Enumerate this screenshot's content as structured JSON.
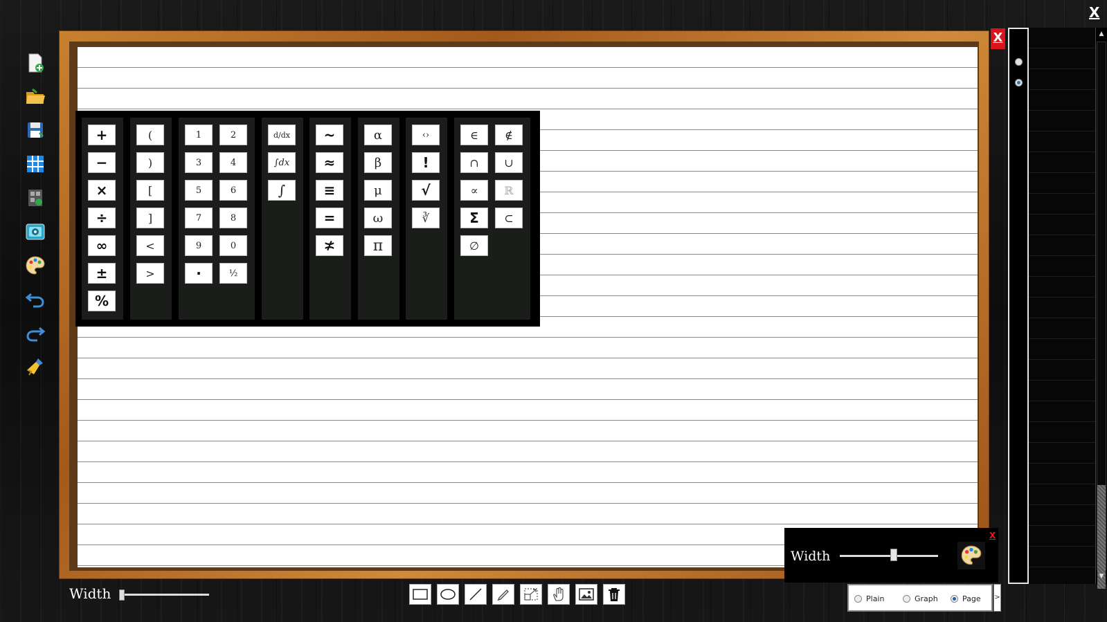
{
  "window": {
    "close_label": "X"
  },
  "left_toolbar": [
    {
      "name": "new-page",
      "icon": "new-page-icon"
    },
    {
      "name": "open",
      "icon": "folder-open-icon"
    },
    {
      "name": "save",
      "icon": "save-icon"
    },
    {
      "name": "grid",
      "icon": "grid-icon"
    },
    {
      "name": "calculator",
      "icon": "calculator-icon"
    },
    {
      "name": "screenshot",
      "icon": "camera-icon"
    },
    {
      "name": "palette",
      "icon": "palette-icon"
    },
    {
      "name": "undo",
      "icon": "undo-icon"
    },
    {
      "name": "redo",
      "icon": "redo-icon"
    },
    {
      "name": "clear",
      "icon": "broom-icon"
    }
  ],
  "board": {
    "close_label": "X"
  },
  "page_strip": {
    "pages": 2,
    "selected_page": 2
  },
  "math_palette": {
    "columns": [
      {
        "keys": [
          "+",
          "−",
          "×",
          "÷",
          "∞",
          "±",
          "%"
        ]
      },
      {
        "keys": [
          "(",
          ")",
          "[",
          "]",
          "<",
          ">"
        ]
      },
      {
        "keys": [
          "1",
          "2",
          "3",
          "4",
          "5",
          "6",
          "7",
          "8",
          "9",
          "0",
          "·",
          "½"
        ]
      },
      {
        "keys": [
          "d/dx",
          "∫dx",
          "∫"
        ]
      },
      {
        "keys": [
          "~",
          "≈",
          "≡",
          "=",
          "≭"
        ]
      },
      {
        "keys": [
          "α",
          "β",
          "μ",
          "ω",
          "π"
        ]
      },
      {
        "keys": [
          "‹›",
          "!",
          "√",
          "∛"
        ]
      },
      {
        "keys": [
          "∈",
          "∉",
          "∩",
          "∪",
          "∝",
          "ℝ",
          "Σ",
          "⊂",
          "∅"
        ]
      }
    ]
  },
  "width_main": {
    "label": "Width",
    "value": 0.0
  },
  "shape_toolbar": [
    {
      "name": "rectangle",
      "icon": "rectangle-icon"
    },
    {
      "name": "ellipse",
      "icon": "ellipse-icon"
    },
    {
      "name": "line",
      "icon": "line-icon"
    },
    {
      "name": "pen",
      "icon": "pen-icon"
    },
    {
      "name": "resize",
      "icon": "resize-icon"
    },
    {
      "name": "pan",
      "icon": "hand-icon"
    },
    {
      "name": "image",
      "icon": "image-icon"
    },
    {
      "name": "delete",
      "icon": "trash-icon"
    }
  ],
  "pen_popup": {
    "close_label": "X",
    "label": "Width",
    "value": 0.55,
    "icon": "palette-icon"
  },
  "background_selector": {
    "options": [
      "Plain",
      "Graph",
      "Page"
    ],
    "selected": "Page",
    "next_label": ">"
  }
}
